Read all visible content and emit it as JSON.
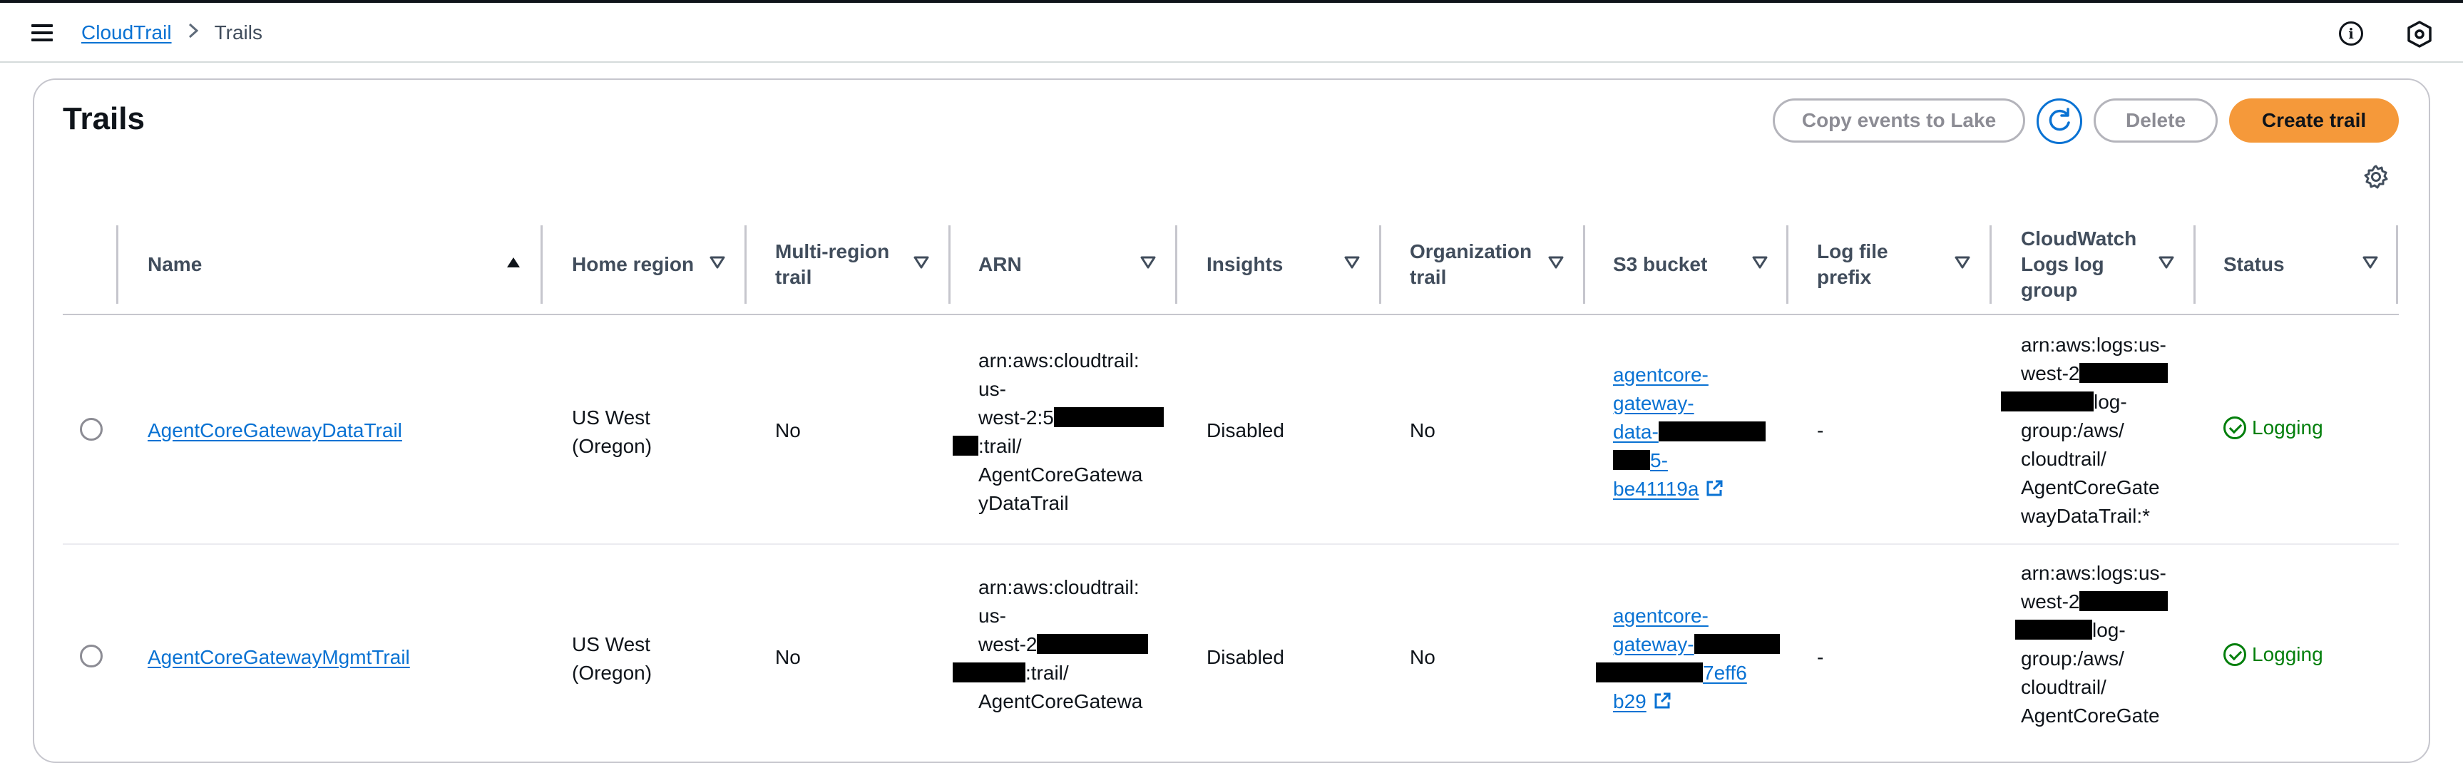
{
  "breadcrumb": {
    "root": "CloudTrail",
    "current": "Trails"
  },
  "page": {
    "title": "Trails"
  },
  "actions": {
    "copy_events": "Copy events to Lake",
    "delete": "Delete",
    "create_trail": "Create trail"
  },
  "columns": {
    "name": "Name",
    "home_region": "Home region",
    "multi_region_1": "Multi-region",
    "multi_region_2": "trail",
    "arn": "ARN",
    "insights": "Insights",
    "organization_1": "Organization",
    "organization_2": "trail",
    "s3_bucket": "S3 bucket",
    "log_prefix_1": "Log file",
    "log_prefix_2": "prefix",
    "cw_1": "CloudWatch",
    "cw_2": "Logs log",
    "cw_3": "group",
    "status": "Status"
  },
  "rows": [
    {
      "name": "AgentCoreGatewayDataTrail",
      "region_1": "US West",
      "region_2": "(Oregon)",
      "multi_region": "No",
      "arn_1": "arn:aws:cloudtrail:",
      "arn_2": "us-",
      "arn_3": "west-2:5",
      "arn_4": ":trail/",
      "arn_5": "AgentCoreGatewa",
      "arn_6": "yDataTrail",
      "insights": "Disabled",
      "organization": "No",
      "s3_1": "agentcore-",
      "s3_2": "gateway-",
      "s3_3": "data-",
      "s3_4": "5-",
      "s3_5": "be41119a",
      "log_prefix": "-",
      "cw_1": "arn:aws:logs:us-",
      "cw_2": "west-2",
      "cw_3": "log-",
      "cw_4": "group:/aws/",
      "cw_5": "cloudtrail/",
      "cw_6": "AgentCoreGate",
      "cw_7": "wayDataTrail:*",
      "status": "Logging"
    },
    {
      "name": "AgentCoreGatewayMgmtTrail",
      "region_1": "US West",
      "region_2": "(Oregon)",
      "multi_region": "No",
      "arn_1": "arn:aws:cloudtrail:",
      "arn_2": "us-",
      "arn_3": "west-2",
      "arn_4": ":trail/",
      "arn_5": "AgentCoreGatewa",
      "insights": "Disabled",
      "organization": "No",
      "s3_1": "agentcore-",
      "s3_2": "gateway-",
      "s3_3": "7eff6",
      "s3_4": "b29",
      "log_prefix": "-",
      "cw_1": "arn:aws:logs:us-",
      "cw_2": "west-2",
      "cw_3": "log-",
      "cw_4": "group:/aws/",
      "cw_5": "cloudtrail/",
      "cw_6": "AgentCoreGate",
      "status": "Logging"
    }
  ]
}
